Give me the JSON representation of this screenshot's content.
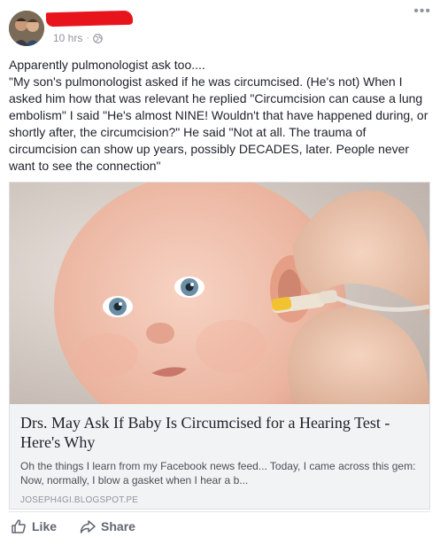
{
  "post": {
    "author_name": "",
    "timestamp": "10 hrs",
    "privacy_icon": "globe-icon",
    "more_icon": "more-options-icon",
    "text": [
      "Apparently pulmonologist ask too....",
      "\"My son's pulmonologist asked if he was circumcised. (He's not) When I asked him how that was relevant he replied \"Circumcision can cause a lung embolism\" I said \"He's almost NINE! Wouldn't that have happened during, or shortly after, the circumcision?\" He said \"Not at all. The trauma of circumcision can show up years, possibly DECADES, later. People never want to see the connection\""
    ]
  },
  "link_card": {
    "title": "Drs. May Ask If Baby Is Circumcised for a Hearing Test - Here's Why",
    "description": "Oh the things I learn from my Facebook news feed... Today, I came across this gem: Now, normally, I blow a gasket when I hear a b...",
    "domain": "JOSEPH4GI.BLOGSPOT.PE"
  },
  "actions": {
    "like_label": "Like",
    "share_label": "Share"
  },
  "colors": {
    "redaction": "#e8141c",
    "meta_gray": "#90949c",
    "card_bg": "#f2f3f5",
    "action_gray": "#606770"
  }
}
